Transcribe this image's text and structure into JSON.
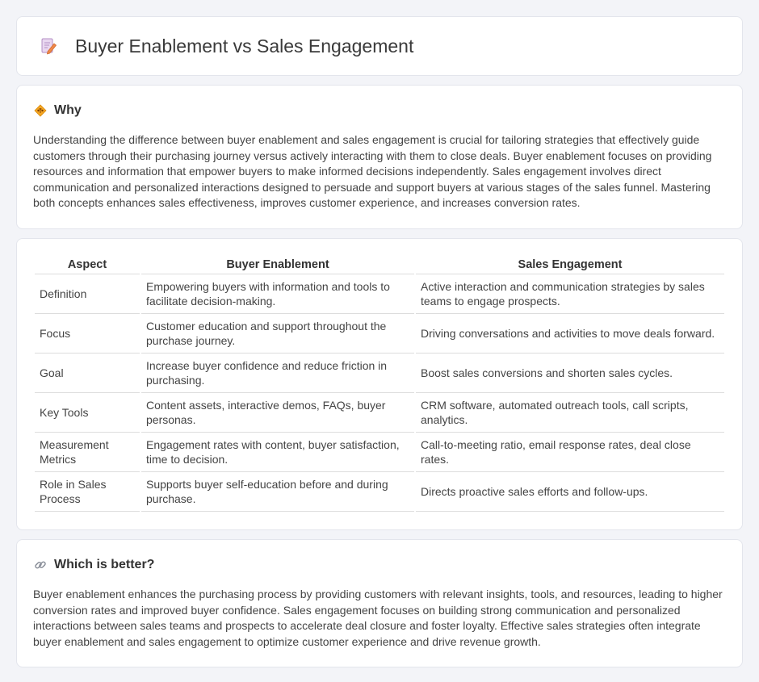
{
  "header": {
    "title": "Buyer Enablement vs Sales Engagement",
    "icon": "document-pencil-icon"
  },
  "why": {
    "title": "Why",
    "icon": "diamond-signal-icon",
    "text": "Understanding the difference between buyer enablement and sales engagement is crucial for tailoring strategies that effectively guide customers through their purchasing journey versus actively interacting with them to close deals. Buyer enablement focuses on providing resources and information that empower buyers to make informed decisions independently. Sales engagement involves direct communication and personalized interactions designed to persuade and support buyers at various stages of the sales funnel. Mastering both concepts enhances sales effectiveness, improves customer experience, and increases conversion rates."
  },
  "table": {
    "headers": [
      "Aspect",
      "Buyer Enablement",
      "Sales Engagement"
    ],
    "rows": [
      [
        "Definition",
        "Empowering buyers with information and tools to facilitate decision-making.",
        "Active interaction and communication strategies by sales teams to engage prospects."
      ],
      [
        "Focus",
        "Customer education and support throughout the purchase journey.",
        "Driving conversations and activities to move deals forward."
      ],
      [
        "Goal",
        "Increase buyer confidence and reduce friction in purchasing.",
        "Boost sales conversions and shorten sales cycles."
      ],
      [
        "Key Tools",
        "Content assets, interactive demos, FAQs, buyer personas.",
        "CRM software, automated outreach tools, call scripts, analytics."
      ],
      [
        "Measurement Metrics",
        "Engagement rates with content, buyer satisfaction, time to decision.",
        "Call-to-meeting ratio, email response rates, deal close rates."
      ],
      [
        "Role in Sales Process",
        "Supports buyer self-education before and during purchase.",
        "Directs proactive sales efforts and follow-ups."
      ]
    ]
  },
  "better": {
    "title": "Which is better?",
    "icon": "link-icon",
    "text": "Buyer enablement enhances the purchasing process by providing customers with relevant insights, tools, and resources, leading to higher conversion rates and improved buyer confidence. Sales engagement focuses on building strong communication and personalized interactions between sales teams and prospects to accelerate deal closure and foster loyalty. Effective sales strategies often integrate buyer enablement and sales engagement to optimize customer experience and drive revenue growth."
  }
}
